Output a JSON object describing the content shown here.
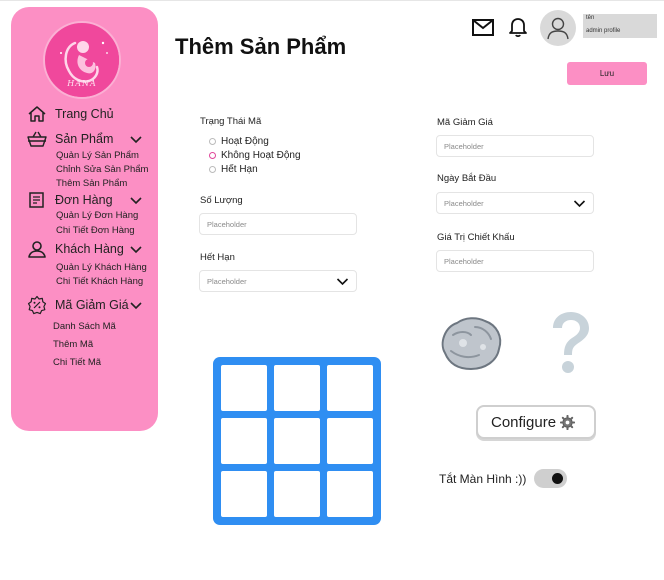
{
  "sidebar": {
    "logo_text": "HANA",
    "sections": [
      {
        "label": "Trang Chủ"
      },
      {
        "label": "Sản Phẩm",
        "items": [
          "Quản Lý Sản Phẩm",
          "Chỉnh Sửa Sản Phẩm",
          "Thêm Sản Phẩm"
        ]
      },
      {
        "label": "Đơn Hàng",
        "items": [
          "Quản Lý Đơn Hàng",
          "Chi Tiết Đơn Hàng"
        ]
      },
      {
        "label": "Khách Hàng",
        "items": [
          "Quản Lý Khách Hàng",
          "Chi Tiết Khách Hàng"
        ]
      },
      {
        "label": "Mã Giảm Giá",
        "items": [
          "Danh Sách Mã",
          "Thêm Mã",
          "Chi Tiết Mã"
        ]
      }
    ]
  },
  "header": {
    "title": "Thêm Sản Phẩm",
    "profile_name": "tên",
    "profile_role": "admin profile",
    "save_label": "Lưu"
  },
  "form": {
    "status_label": "Trạng Thái Mã",
    "status_options": [
      {
        "label": "Hoạt Động",
        "selected": false
      },
      {
        "label": "Không Hoạt Động",
        "selected": true
      },
      {
        "label": "Hết Hạn",
        "selected": false
      }
    ],
    "quantity_label": "Số Lượng",
    "quantity_placeholder": "Placeholder",
    "expiry_label": "Hết Hạn",
    "expiry_placeholder": "Placeholder",
    "code_label": "Mã Giảm Giá",
    "code_placeholder": "Placeholder",
    "start_date_label": "Ngày Bắt Đầu",
    "start_date_placeholder": "Placeholder",
    "discount_value_label": "Giá Trị Chiết Khấu",
    "discount_value_placeholder": "Placeholder"
  },
  "actions": {
    "configure_label": "Configure",
    "toggle_label": "Tắt Màn Hình :))",
    "toggle_on": true
  },
  "colors": {
    "sidebar_bg": "#fc8fc4",
    "accent_pink": "#e0479a",
    "grid_blue": "#2f8ef2"
  },
  "icons": [
    "home-icon",
    "basket-icon",
    "document-icon",
    "user-icon",
    "discount-badge-icon",
    "mail-icon",
    "bell-icon",
    "user-avatar-icon",
    "gear-icon",
    "rock-icon",
    "question-mark-icon",
    "grid-icon"
  ]
}
